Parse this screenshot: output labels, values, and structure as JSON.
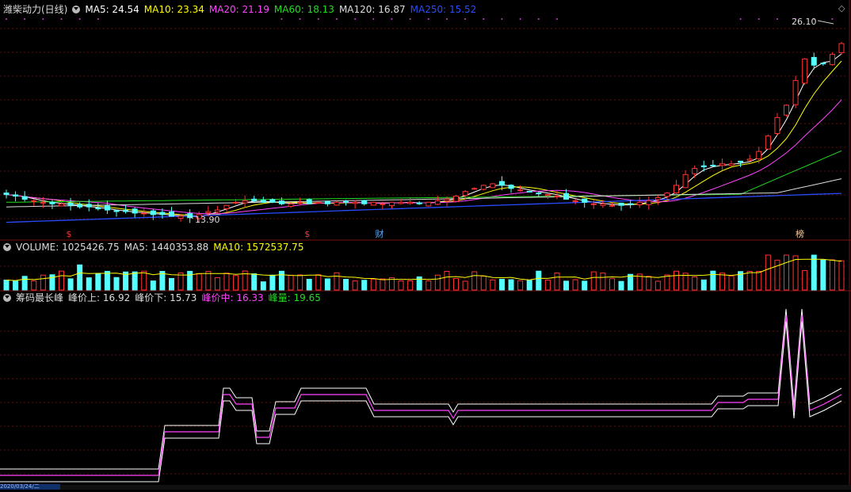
{
  "main_panel": {
    "title": "潍柴动力(日线)",
    "indicators": [
      {
        "label": "MA5: 24.54",
        "color": "#ffffff"
      },
      {
        "label": "MA10: 23.34",
        "color": "#ffff00"
      },
      {
        "label": "MA20: 21.19",
        "color": "#ff44ff"
      },
      {
        "label": "MA60: 18.13",
        "color": "#22dd22"
      },
      {
        "label": "MA120: 16.87",
        "color": "#dddddd"
      },
      {
        "label": "MA250: 15.52",
        "color": "#2a4cff"
      }
    ],
    "high_label": "26.10",
    "low_label": "13.90",
    "markers": [
      {
        "text": "$",
        "color": "#ff3333",
        "x_pct": 0.081
      },
      {
        "text": "$",
        "color": "#ff3333",
        "x_pct": 0.361
      },
      {
        "text": "财",
        "color": "#55aaff",
        "x_pct": 0.446
      },
      {
        "text": "榜",
        "color": "#ffcc99",
        "x_pct": 0.94
      }
    ]
  },
  "volume_panel": {
    "indicators": [
      {
        "label": "VOLUME: 1025426.75",
        "color": "#dddddd"
      },
      {
        "label": "MA5: 1440353.88",
        "color": "#dddddd"
      },
      {
        "label": "MA10: 1572537.75",
        "color": "#ffff00"
      }
    ]
  },
  "chip_panel": {
    "indicators": [
      {
        "label": "筹码最长峰",
        "color": "#dddddd"
      },
      {
        "label": "峰价上: 16.92",
        "color": "#dddddd"
      },
      {
        "label": "峰价下: 15.73",
        "color": "#dddddd"
      },
      {
        "label": "峰价中: 16.33",
        "color": "#ff44ff"
      },
      {
        "label": "峰量: 19.65",
        "color": "#22dd22"
      }
    ]
  },
  "footer": {
    "date_label": "2020/03/24/二"
  },
  "chart_data": {
    "type": "candlestick",
    "title": "潍柴动力(日线)",
    "price_range": [
      12.5,
      27.0
    ],
    "extremes": {
      "high": 26.1,
      "low": 13.9
    },
    "close_series": [
      15.4,
      15.3,
      15.1,
      15.0,
      14.9,
      14.8,
      14.8,
      14.7,
      14.6,
      14.6,
      14.5,
      14.4,
      14.3,
      14.3,
      14.2,
      14.2,
      14.1,
      14.1,
      14.0,
      14.0,
      13.9,
      14.1,
      14.3,
      14.4,
      14.7,
      14.9,
      15.0,
      15.0,
      14.9,
      14.9,
      14.8,
      14.8,
      14.9,
      14.8,
      14.9,
      14.8,
      14.9,
      14.9,
      14.9,
      14.8,
      14.9,
      14.8,
      14.9,
      14.9,
      14.9,
      14.8,
      14.9,
      15.0,
      15.1,
      15.3,
      15.6,
      15.8,
      16.0,
      16.1,
      16.0,
      15.8,
      15.7,
      15.6,
      15.5,
      15.4,
      15.3,
      15.1,
      15.0,
      14.9,
      14.8,
      14.8,
      14.7,
      14.7,
      14.8,
      14.9,
      15.0,
      15.2,
      15.5,
      16.0,
      16.7,
      17.1,
      17.2,
      17.3,
      17.4,
      17.4,
      17.5,
      17.7,
      18.2,
      19.2,
      20.4,
      21.2,
      22.8,
      24.2,
      23.8,
      23.9,
      24.5,
      25.2
    ],
    "moving_averages": {
      "MA5": 24.54,
      "MA10": 23.34,
      "MA20": 21.19,
      "MA60": 18.13,
      "MA120": 16.87,
      "MA250": 15.52
    },
    "volume": {
      "VOLUME": 1025426.75,
      "MA5": 1440353.88,
      "MA10": 1572537.75
    },
    "chip_peak": {
      "上": 16.92,
      "下": 15.73,
      "中": 16.33,
      "峰量": 19.65
    }
  }
}
